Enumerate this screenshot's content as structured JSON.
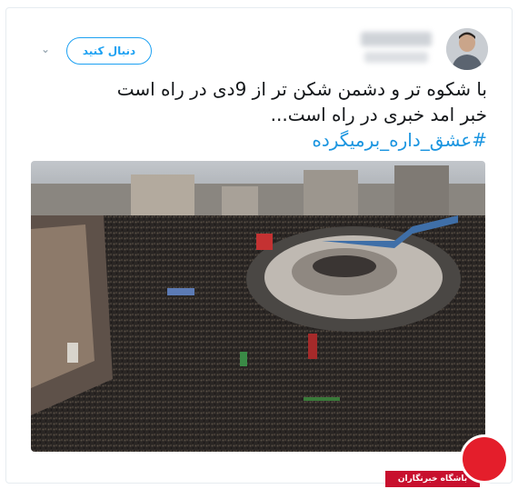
{
  "tweet": {
    "follow_label": "دنبال کنید",
    "text_line_1": "با شکوه تر و دشمن شکن تر از 9دی در راه است",
    "text_line_2": "خبر امد خبری در راه است...",
    "hashtag": "#عشق_داره_برمیگرده"
  },
  "watermark": {
    "label": "باشگاه خبرنگاران"
  },
  "icons": {
    "menu": "chevron-down-icon",
    "avatar": "avatar",
    "logo": "yjc-logo"
  },
  "colors": {
    "accent": "#1da1f2",
    "hashtag": "#1b95e0",
    "text": "#14171a",
    "watermark_red": "#c8102e"
  }
}
